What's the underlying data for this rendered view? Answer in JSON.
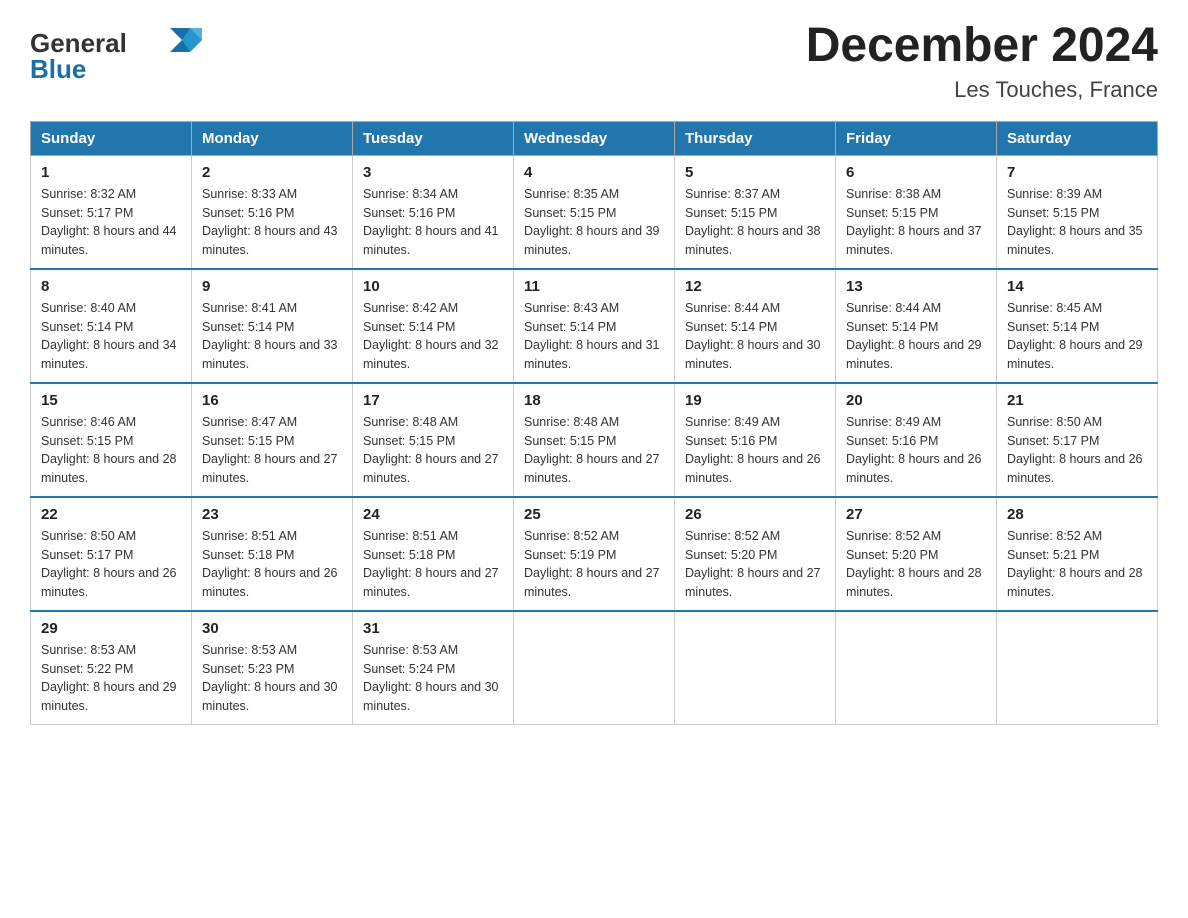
{
  "header": {
    "logo_general": "General",
    "logo_blue": "Blue",
    "month_year": "December 2024",
    "location": "Les Touches, France"
  },
  "weekdays": [
    "Sunday",
    "Monday",
    "Tuesday",
    "Wednesday",
    "Thursday",
    "Friday",
    "Saturday"
  ],
  "weeks": [
    [
      {
        "day": "1",
        "sunrise": "8:32 AM",
        "sunset": "5:17 PM",
        "daylight": "8 hours and 44 minutes."
      },
      {
        "day": "2",
        "sunrise": "8:33 AM",
        "sunset": "5:16 PM",
        "daylight": "8 hours and 43 minutes."
      },
      {
        "day": "3",
        "sunrise": "8:34 AM",
        "sunset": "5:16 PM",
        "daylight": "8 hours and 41 minutes."
      },
      {
        "day": "4",
        "sunrise": "8:35 AM",
        "sunset": "5:15 PM",
        "daylight": "8 hours and 39 minutes."
      },
      {
        "day": "5",
        "sunrise": "8:37 AM",
        "sunset": "5:15 PM",
        "daylight": "8 hours and 38 minutes."
      },
      {
        "day": "6",
        "sunrise": "8:38 AM",
        "sunset": "5:15 PM",
        "daylight": "8 hours and 37 minutes."
      },
      {
        "day": "7",
        "sunrise": "8:39 AM",
        "sunset": "5:15 PM",
        "daylight": "8 hours and 35 minutes."
      }
    ],
    [
      {
        "day": "8",
        "sunrise": "8:40 AM",
        "sunset": "5:14 PM",
        "daylight": "8 hours and 34 minutes."
      },
      {
        "day": "9",
        "sunrise": "8:41 AM",
        "sunset": "5:14 PM",
        "daylight": "8 hours and 33 minutes."
      },
      {
        "day": "10",
        "sunrise": "8:42 AM",
        "sunset": "5:14 PM",
        "daylight": "8 hours and 32 minutes."
      },
      {
        "day": "11",
        "sunrise": "8:43 AM",
        "sunset": "5:14 PM",
        "daylight": "8 hours and 31 minutes."
      },
      {
        "day": "12",
        "sunrise": "8:44 AM",
        "sunset": "5:14 PM",
        "daylight": "8 hours and 30 minutes."
      },
      {
        "day": "13",
        "sunrise": "8:44 AM",
        "sunset": "5:14 PM",
        "daylight": "8 hours and 29 minutes."
      },
      {
        "day": "14",
        "sunrise": "8:45 AM",
        "sunset": "5:14 PM",
        "daylight": "8 hours and 29 minutes."
      }
    ],
    [
      {
        "day": "15",
        "sunrise": "8:46 AM",
        "sunset": "5:15 PM",
        "daylight": "8 hours and 28 minutes."
      },
      {
        "day": "16",
        "sunrise": "8:47 AM",
        "sunset": "5:15 PM",
        "daylight": "8 hours and 27 minutes."
      },
      {
        "day": "17",
        "sunrise": "8:48 AM",
        "sunset": "5:15 PM",
        "daylight": "8 hours and 27 minutes."
      },
      {
        "day": "18",
        "sunrise": "8:48 AM",
        "sunset": "5:15 PM",
        "daylight": "8 hours and 27 minutes."
      },
      {
        "day": "19",
        "sunrise": "8:49 AM",
        "sunset": "5:16 PM",
        "daylight": "8 hours and 26 minutes."
      },
      {
        "day": "20",
        "sunrise": "8:49 AM",
        "sunset": "5:16 PM",
        "daylight": "8 hours and 26 minutes."
      },
      {
        "day": "21",
        "sunrise": "8:50 AM",
        "sunset": "5:17 PM",
        "daylight": "8 hours and 26 minutes."
      }
    ],
    [
      {
        "day": "22",
        "sunrise": "8:50 AM",
        "sunset": "5:17 PM",
        "daylight": "8 hours and 26 minutes."
      },
      {
        "day": "23",
        "sunrise": "8:51 AM",
        "sunset": "5:18 PM",
        "daylight": "8 hours and 26 minutes."
      },
      {
        "day": "24",
        "sunrise": "8:51 AM",
        "sunset": "5:18 PM",
        "daylight": "8 hours and 27 minutes."
      },
      {
        "day": "25",
        "sunrise": "8:52 AM",
        "sunset": "5:19 PM",
        "daylight": "8 hours and 27 minutes."
      },
      {
        "day": "26",
        "sunrise": "8:52 AM",
        "sunset": "5:20 PM",
        "daylight": "8 hours and 27 minutes."
      },
      {
        "day": "27",
        "sunrise": "8:52 AM",
        "sunset": "5:20 PM",
        "daylight": "8 hours and 28 minutes."
      },
      {
        "day": "28",
        "sunrise": "8:52 AM",
        "sunset": "5:21 PM",
        "daylight": "8 hours and 28 minutes."
      }
    ],
    [
      {
        "day": "29",
        "sunrise": "8:53 AM",
        "sunset": "5:22 PM",
        "daylight": "8 hours and 29 minutes."
      },
      {
        "day": "30",
        "sunrise": "8:53 AM",
        "sunset": "5:23 PM",
        "daylight": "8 hours and 30 minutes."
      },
      {
        "day": "31",
        "sunrise": "8:53 AM",
        "sunset": "5:24 PM",
        "daylight": "8 hours and 30 minutes."
      },
      null,
      null,
      null,
      null
    ]
  ],
  "labels": {
    "sunrise_prefix": "Sunrise: ",
    "sunset_prefix": "Sunset: ",
    "daylight_prefix": "Daylight: "
  }
}
